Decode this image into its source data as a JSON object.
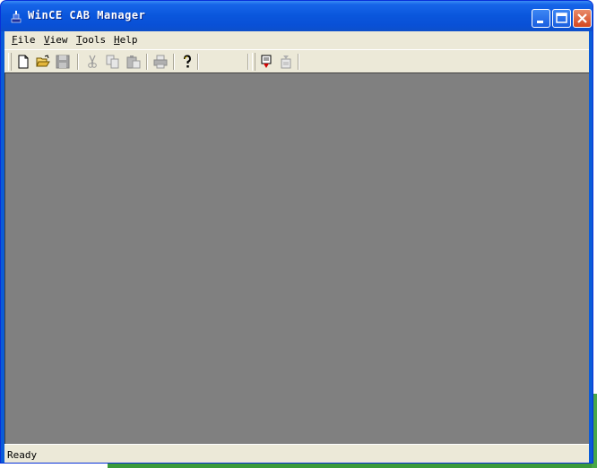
{
  "window": {
    "title": "WinCE CAB Manager"
  },
  "menu": {
    "items": [
      {
        "accel": "F",
        "rest": "ile"
      },
      {
        "accel": "V",
        "rest": "iew"
      },
      {
        "accel": "T",
        "rest": "ools"
      },
      {
        "accel": "H",
        "rest": "elp"
      }
    ]
  },
  "toolbar": {
    "buttons": [
      "new-file-icon",
      "open-folder-icon",
      "save-icon",
      "cut-icon",
      "copy-icon",
      "paste-icon",
      "print-icon",
      "help-icon",
      "insert-file-icon",
      "extract-file-icon"
    ]
  },
  "status": {
    "text": "Ready"
  },
  "colors": {
    "titlebar": "#0a56dc",
    "workspace": "#808080",
    "chrome": "#ece9d8"
  }
}
